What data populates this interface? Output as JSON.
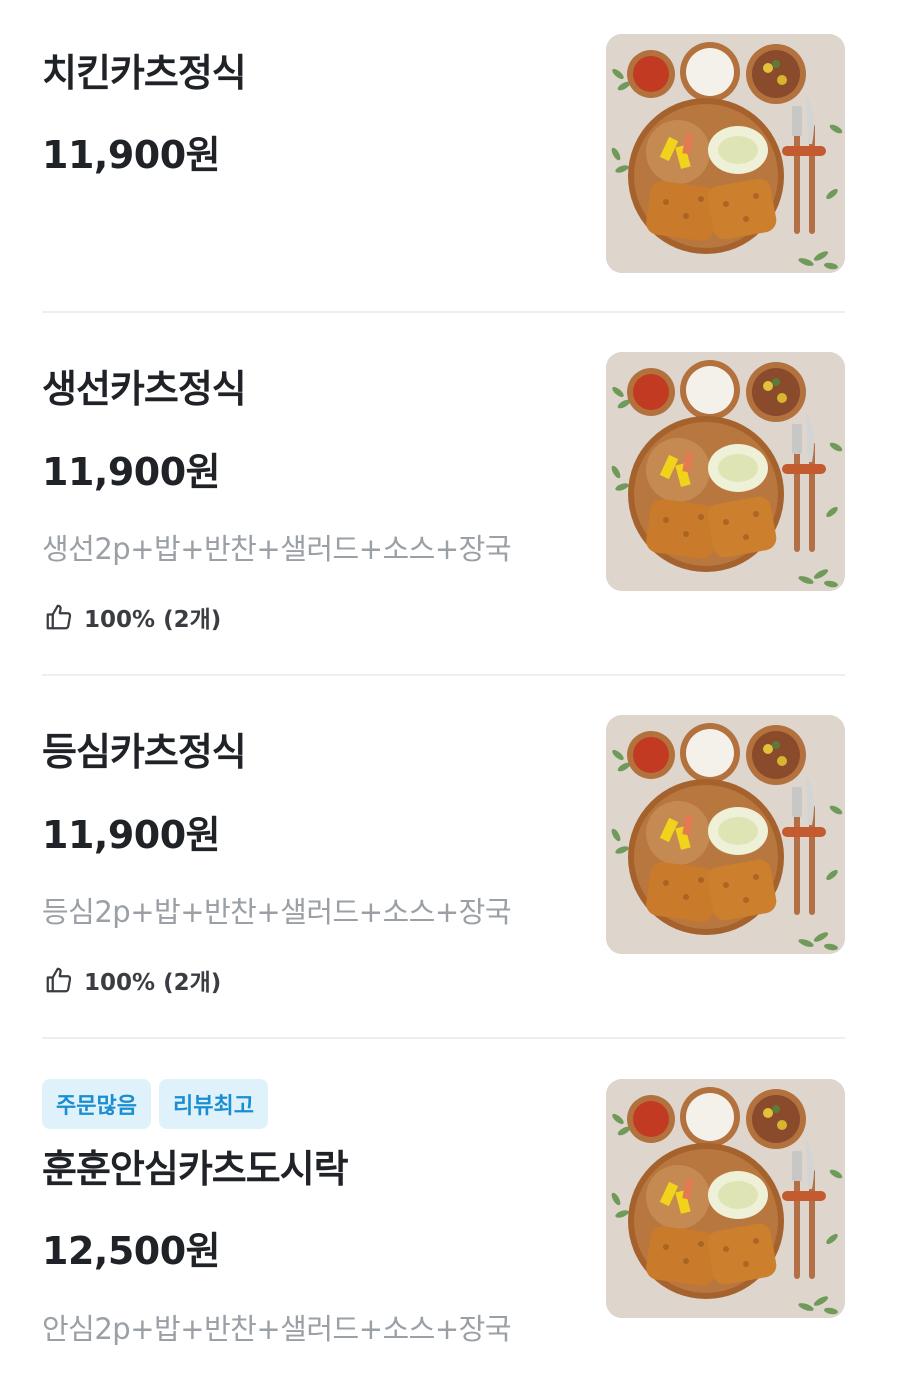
{
  "menu": {
    "items": [
      {
        "name": "치킨카츠정식",
        "price": "11,900원",
        "description": "",
        "rating": "",
        "badges": []
      },
      {
        "name": "생선카츠정식",
        "price": "11,900원",
        "description": "생선2p+밥+반찬+샐러드+소스+장국",
        "rating": "100% (2개)",
        "badges": []
      },
      {
        "name": "등심카츠정식",
        "price": "11,900원",
        "description": "등심2p+밥+반찬+샐러드+소스+장국",
        "rating": "100% (2개)",
        "badges": []
      },
      {
        "name": "훈훈안심카츠도시락",
        "price": "12,500원",
        "description": "안심2p+밥+반찬+샐러드+소스+장국",
        "rating": "",
        "badges": [
          "주문많음",
          "리뷰최고"
        ]
      }
    ]
  },
  "icons": {
    "rating": "thumbs-up-icon"
  },
  "colors": {
    "badge_bg": "#dff2fc",
    "badge_text": "#1b8ecf",
    "description": "#9aa0a6",
    "divider": "#eceef0"
  }
}
